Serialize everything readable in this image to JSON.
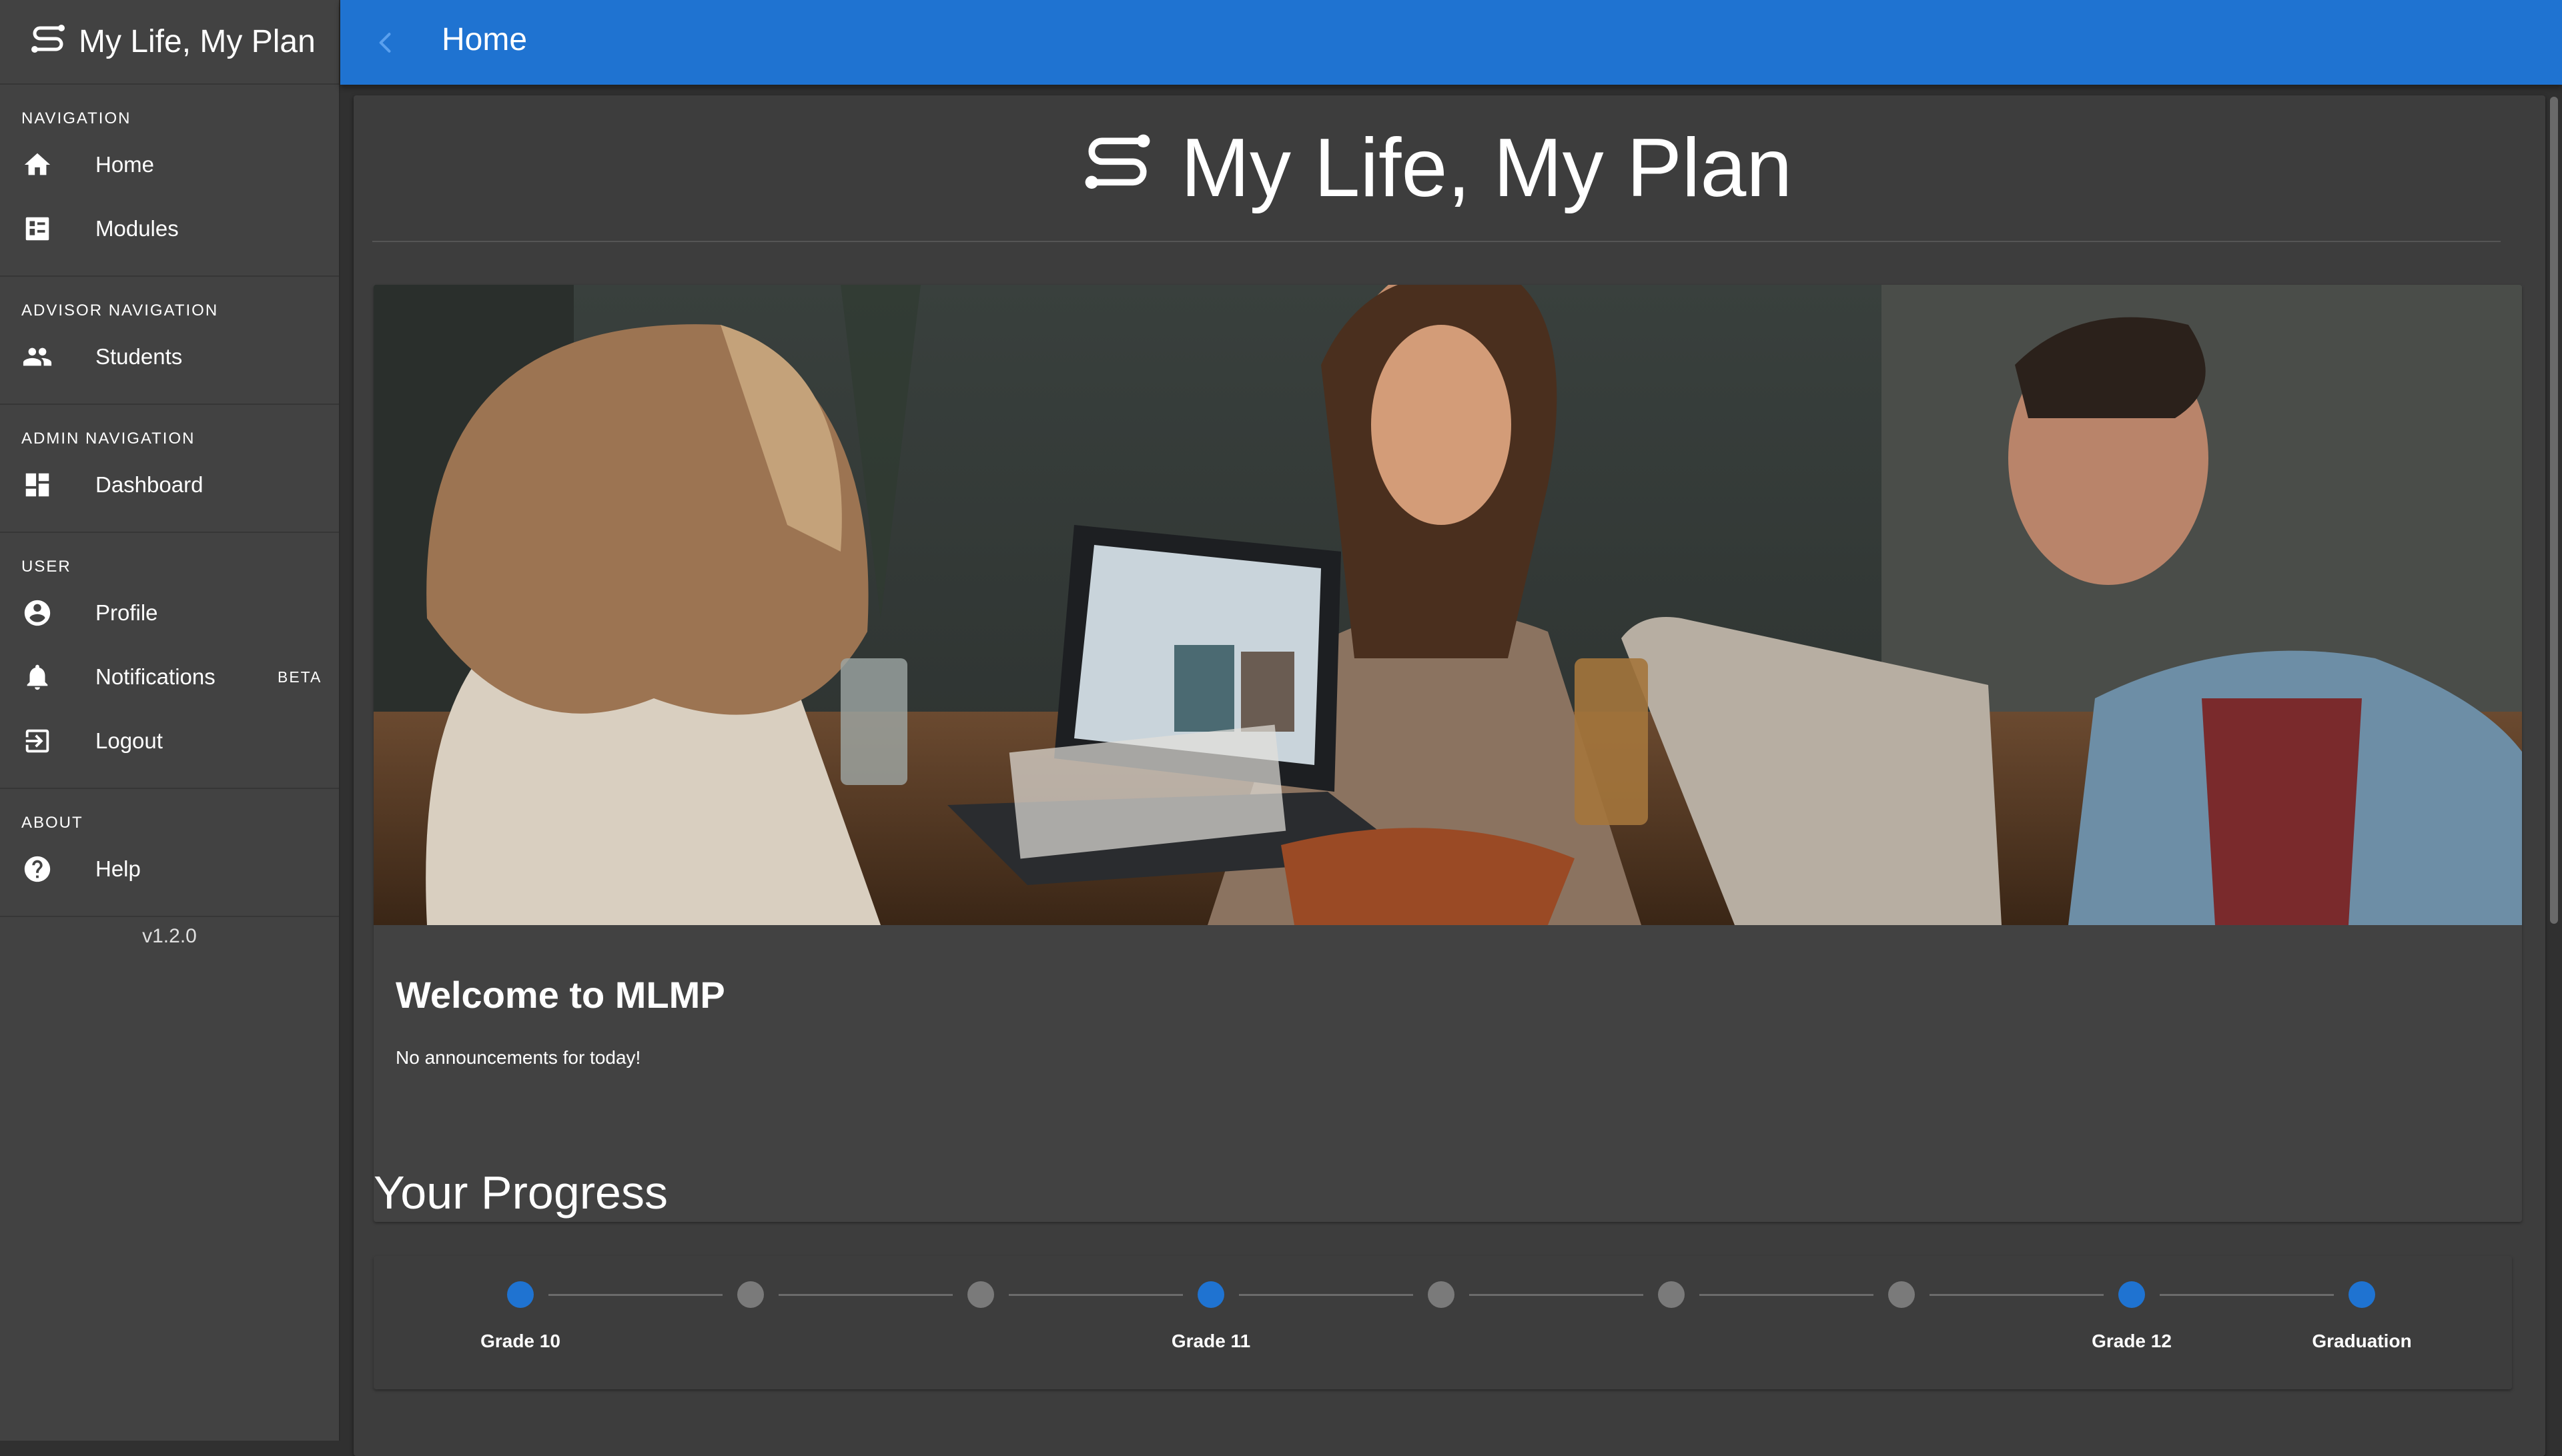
{
  "app": {
    "title": "My Life, My Plan",
    "version": "v1.2.0"
  },
  "sidebar": {
    "sections": [
      {
        "label": "NAVIGATION",
        "items": [
          {
            "label": "Home",
            "icon": "home-icon"
          },
          {
            "label": "Modules",
            "icon": "modules-icon"
          }
        ]
      },
      {
        "label": "ADVISOR NAVIGATION",
        "items": [
          {
            "label": "Students",
            "icon": "people-icon"
          }
        ]
      },
      {
        "label": "ADMIN NAVIGATION",
        "items": [
          {
            "label": "Dashboard",
            "icon": "dashboard-icon"
          }
        ]
      },
      {
        "label": "USER",
        "items": [
          {
            "label": "Profile",
            "icon": "account-circle-icon"
          },
          {
            "label": "Notifications",
            "icon": "bell-icon",
            "badge": "BETA"
          },
          {
            "label": "Logout",
            "icon": "logout-icon"
          }
        ]
      },
      {
        "label": "ABOUT",
        "items": [
          {
            "label": "Help",
            "icon": "help-icon"
          }
        ]
      }
    ]
  },
  "appbar": {
    "title": "Home",
    "back_icon": "chevron-left-icon"
  },
  "main": {
    "heading": "My Life, My Plan",
    "welcome": {
      "title": "Welcome to MLMP",
      "text": "No announcements for today!"
    },
    "progress": {
      "title": "Your Progress",
      "steps": [
        {
          "label": "Grade 10",
          "active": true
        },
        {
          "label": "",
          "active": false
        },
        {
          "label": "",
          "active": false
        },
        {
          "label": "Grade 11",
          "active": true
        },
        {
          "label": "",
          "active": false
        },
        {
          "label": "",
          "active": false
        },
        {
          "label": "",
          "active": false
        },
        {
          "label": "Grade 12",
          "active": true
        },
        {
          "label": "Graduation",
          "active": true
        }
      ]
    }
  },
  "colors": {
    "primary": "#1f73d1",
    "active_step": "#1f73d1",
    "inactive_step": "#7a7a7a",
    "sidebar_bg": "#424242",
    "page_bg": "#303030"
  }
}
